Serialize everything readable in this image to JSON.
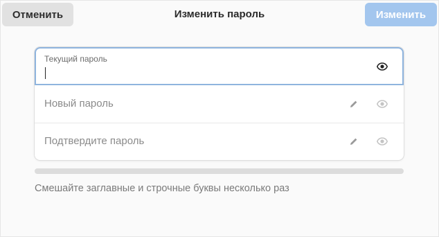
{
  "header": {
    "cancel_label": "Отменить",
    "title": "Изменить пароль",
    "change_label": "Изменить"
  },
  "form": {
    "current": {
      "label": "Текущий пароль",
      "value": ""
    },
    "new": {
      "placeholder": "Новый пароль"
    },
    "confirm": {
      "placeholder": "Подтвердите пароль"
    }
  },
  "strength": {
    "level": 0
  },
  "hint": "Смешайте заглавные и строчные буквы несколько раз",
  "colors": {
    "accent_disabled": "#a3c6ee",
    "focus_border": "#8fb4de"
  },
  "icons": {
    "reveal": "eye-icon",
    "generate": "pencil-icon"
  }
}
